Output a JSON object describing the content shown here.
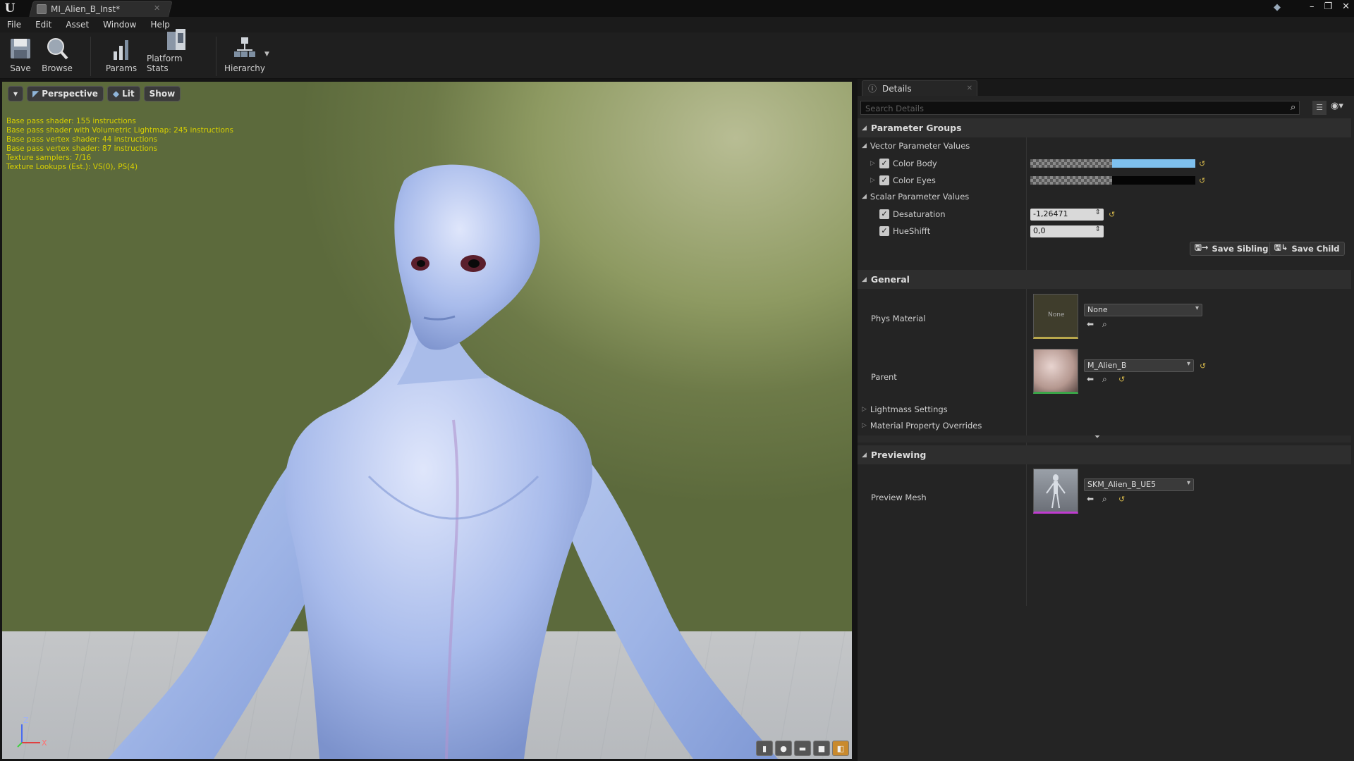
{
  "window": {
    "tab_title": "MI_Alien_B_Inst*"
  },
  "menu": [
    "File",
    "Edit",
    "Asset",
    "Window",
    "Help"
  ],
  "toolbar": {
    "save": "Save",
    "browse": "Browse",
    "params": "Params",
    "platform_stats": "Platform Stats",
    "hierarchy": "Hierarchy"
  },
  "viewport": {
    "perspective": "Perspective",
    "lit": "Lit",
    "show": "Show",
    "stats": [
      "Base pass shader: 155 instructions",
      "Base pass shader with Volumetric Lightmap: 245 instructions",
      "Base pass vertex shader: 44 instructions",
      "Base pass vertex shader: 87 instructions",
      "Texture samplers: 7/16",
      "Texture Lookups (Est.): VS(0), PS(4)"
    ],
    "axis": {
      "z": "Z",
      "x": "X"
    }
  },
  "details": {
    "tab_label": "Details",
    "search_placeholder": "Search Details",
    "parameter_groups": {
      "label": "Parameter Groups",
      "vector_label": "Vector Parameter Values",
      "color_body": {
        "label": "Color Body",
        "color": "#7ec0ee"
      },
      "color_eyes": {
        "label": "Color Eyes",
        "color": "#050505"
      },
      "scalar_label": "Scalar Parameter Values",
      "desaturation": {
        "label": "Desaturation",
        "value": "-1,26471"
      },
      "hueshift": {
        "label": "HueShifft",
        "value": "0,0"
      },
      "save_sibling": "Save Sibling",
      "save_child": "Save Child"
    },
    "general": {
      "label": "General",
      "phys_material": {
        "label": "Phys Material",
        "thumb_text": "None",
        "value": "None"
      },
      "parent": {
        "label": "Parent",
        "value": "M_Alien_B"
      },
      "lightmass": "Lightmass Settings",
      "material_overrides": "Material Property Overrides"
    },
    "previewing": {
      "label": "Previewing",
      "preview_mesh": {
        "label": "Preview Mesh",
        "value": "SKM_Alien_B_UE5"
      }
    }
  },
  "colors": {
    "accent_yellow": "#d2b64a",
    "stats_text": "#d8d000",
    "body_swatch": "#7ec0ee"
  }
}
